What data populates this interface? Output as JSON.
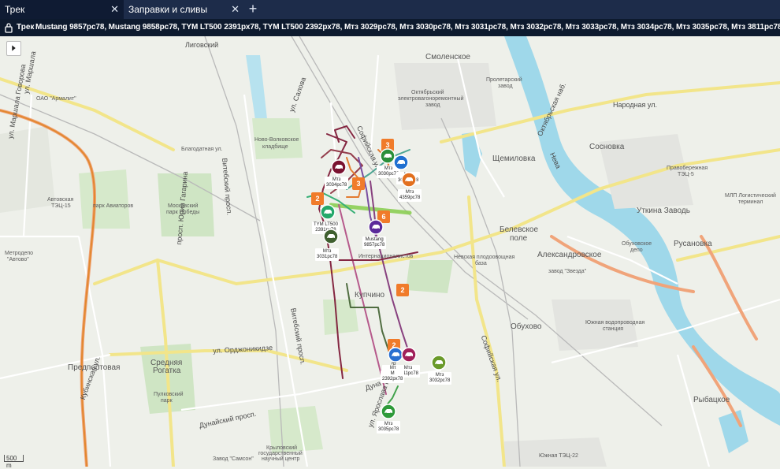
{
  "tabs": [
    {
      "label": "Трек",
      "active": true
    },
    {
      "label": "Заправки и сливы",
      "active": false
    }
  ],
  "track": {
    "label": "Трек",
    "vehicles": "Mustang 9857рс78, Mustang 9858рс78, TYM LT500 2391рх78, TYM LT500 2392рх78, Мтз 3029рс78, Мтз 3030рс78, Мтз 3031рс78, Мтз 3032рс78, Мтз 3033рс78, Мтз 3034рс78, Мтз 3035рс78, Мтз 3811рс78, Мтз 3812рс78, Мтз 3879рс78, Мтз 3881рс78, Мтз 4359рс78"
  },
  "scale": "500 m",
  "map_labels": {
    "smolenskoe": "Смоленское",
    "shchemilovka": "Щемиловка",
    "sosnovka": "Сосновка",
    "utkina": "Уткина Заводь",
    "rusanovka": "Русановка",
    "alexandrovskoe": "Александровское",
    "belevskoe": "Белевское",
    "pole": "поле",
    "obukhovo": "Обухово",
    "rybatskoe": "Рыбацкое",
    "kupchino": "Купчино",
    "predportovaya": "Предпортовая",
    "srednyaya": "Средняя",
    "rogatka": "Рогатка",
    "ligovsky": "Лиговский",
    "narodnaya": "Народная ул.",
    "novo_volk": "Ново-Волковское",
    "kladbishche": "кладбище",
    "moskovsky": "Московский",
    "park_pobedy": "парк Победы",
    "park_aviatorov": "парк Авиаторов",
    "avtovo_tec": "Автовская",
    "tec15": "ТЭЦ-15",
    "armalit": "ОАО \"Армалит\"",
    "metrodepo": "Метродепо",
    "avtovo": "\"Автово\"",
    "blagodatnaya": "Благодатная ул.",
    "ul_salova": "ул. Салова",
    "sofiyskaya_top": "Софийская ул.",
    "sofiyskaya_bottom": "Софийская ул.",
    "internacionalistov": "Интернационалистов",
    "nevskaya_baza": "Невская плодоовощная",
    "baza": "база",
    "zvezda": "завод \"Звезда\"",
    "obukhovskoe": "Обуховское",
    "depo": "депо",
    "proletarsky": "Пролетарский",
    "zavod": "завод",
    "oktyabrsky": "Октябрьский",
    "elektrovag": "электровагоноремонтный",
    "zavod2": "завод",
    "pravober": "Правобережная",
    "tec5": "ТЭЦ-5",
    "mlp": "МЛП Логистический",
    "terminal": "терминал",
    "yuzhnaya_vod": "Южная водопроводная",
    "stanciya": "станция",
    "yuzhnaya_tec": "Южная ТЭЦ-22",
    "pulkovsky": "Пулковский",
    "park": "парк",
    "dunaysky": "Дунайский просп.",
    "ordzhonikidze": "ул. Орджоникидзе",
    "vitebsky": "Витебский просп.",
    "vitebsky2": "Витебский просп.",
    "kubinskaya": "Кубинская ул.",
    "oktyabrskaya_nab": "Октябрьская наб.",
    "neva": "Нева",
    "krylovsky": "Крыловский",
    "gos": "государственный",
    "nauch": "научный центр",
    "samson": "Завод \"Самсон\"",
    "mar_govorova": "ул. Маршала Говорова",
    "ul_marshala": "ул. Маршала",
    "prosp_yuriya": "просп. Юрия Гагарина",
    "prazhskaya": "Пражская",
    "ul_gasheka": "ул. Ярослава Гашека",
    "dunaysky2": "Дуна"
  },
  "vehicles": [
    {
      "name": "Мтз",
      "plate": "3034рс78",
      "color": "#7a1230"
    },
    {
      "name": "Мтз",
      "plate": "3030рс78",
      "color": "#2a8f3a"
    },
    {
      "name": "Мтз",
      "plate": "3029рс78",
      "color": "#1f6fd0"
    },
    {
      "name": "Мтз",
      "plate": "4359рс78",
      "color": "#e2701f"
    },
    {
      "name": "TYM LT500",
      "plate": "2391рх78",
      "color": "#24a86a"
    },
    {
      "name": "Мтз",
      "plate": "3031рс78",
      "color": "#3f5f2f"
    },
    {
      "name": "Mustang",
      "plate": "9857рс78",
      "color": "#5b2a9a"
    },
    {
      "name": "Мтз",
      "plate": "3879рс78",
      "color": "#2a6fd0"
    },
    {
      "name": "Мтз",
      "plate": "3811рс78",
      "color": "#a0205a"
    },
    {
      "name": "Мтз",
      "plate": "3032рс78",
      "color": "#6a9a2a"
    },
    {
      "name": "Мтз",
      "plate": "3035рс78",
      "color": "#2f9a3a"
    }
  ],
  "label_extra": {
    "m": "М",
    "k2392": "2392рх78"
  },
  "events": [
    "3",
    "3",
    "2",
    "6",
    "2",
    "2"
  ],
  "colors": {
    "tabbar": "#1d2c4a",
    "trackbar": "#0d1a2e",
    "event": "#f07b2a",
    "water": "#9fd8ea",
    "park": "#cfe5c4",
    "road_major": "#f2e58a"
  }
}
